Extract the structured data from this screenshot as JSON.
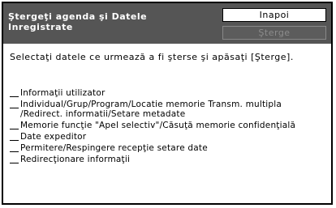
{
  "header": {
    "title": "Ştergeţi agenda şi Datele Inregistrate",
    "back_label": "Inapoi",
    "delete_label": "Şterge"
  },
  "instruction": "Selectaţi datele ce urmează a fi şterse şi apăsaţi [Şterge].",
  "items": [
    {
      "label": "Informaţii utilizator",
      "checked": false
    },
    {
      "label": "Individual/Grup/Program/Locatie memorie Transm. multipla /Redirect. informatii/Setare metadate",
      "checked": false
    },
    {
      "label": "Memorie funcţie \"Apel selectiv\"/Căsuţă memorie confidenţială",
      "checked": false
    },
    {
      "label": "Date expeditor",
      "checked": false
    },
    {
      "label": "Permitere/Respingere recepţie setare date",
      "checked": false
    },
    {
      "label": "Redirecţionare informaţii",
      "checked": false
    }
  ],
  "colors": {
    "titlebar_bg": "#555555",
    "disabled_button_bg": "#5c5c5c",
    "disabled_button_text": "#8c8c8c"
  }
}
